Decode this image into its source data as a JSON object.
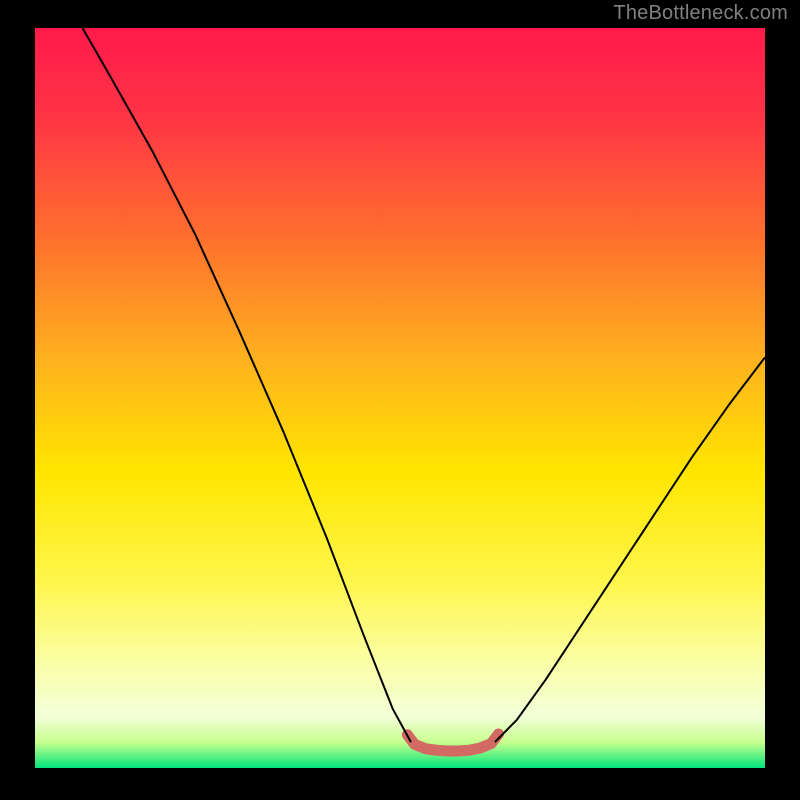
{
  "watermark": "TheBottleneck.com",
  "chart_data": {
    "type": "line",
    "title": "",
    "xlabel": "",
    "ylabel": "",
    "xlim": [
      0,
      100
    ],
    "ylim": [
      0,
      100
    ],
    "background_gradient_stops": [
      {
        "offset": 0.0,
        "color": "#ff1a4b"
      },
      {
        "offset": 0.12,
        "color": "#ff3445"
      },
      {
        "offset": 0.28,
        "color": "#ff6e2e"
      },
      {
        "offset": 0.45,
        "color": "#ffb21e"
      },
      {
        "offset": 0.6,
        "color": "#ffe600"
      },
      {
        "offset": 0.75,
        "color": "#fff64d"
      },
      {
        "offset": 0.86,
        "color": "#fbffa8"
      },
      {
        "offset": 0.93,
        "color": "#f3ffd8"
      },
      {
        "offset": 0.965,
        "color": "#c8ff8f"
      },
      {
        "offset": 1.0,
        "color": "#00e67a"
      }
    ],
    "series": [
      {
        "name": "left-branch",
        "stroke": "#000000",
        "stroke_width": 2.0,
        "points": [
          {
            "x": 6.5,
            "y": 100.0
          },
          {
            "x": 10.0,
            "y": 94.0
          },
          {
            "x": 16.0,
            "y": 83.5
          },
          {
            "x": 22.0,
            "y": 72.0
          },
          {
            "x": 28.0,
            "y": 59.0
          },
          {
            "x": 34.0,
            "y": 45.5
          },
          {
            "x": 40.0,
            "y": 31.0
          },
          {
            "x": 45.0,
            "y": 18.0
          },
          {
            "x": 49.0,
            "y": 8.0
          },
          {
            "x": 51.5,
            "y": 3.5
          }
        ]
      },
      {
        "name": "right-branch",
        "stroke": "#000000",
        "stroke_width": 2.0,
        "points": [
          {
            "x": 63.0,
            "y": 3.5
          },
          {
            "x": 66.0,
            "y": 6.5
          },
          {
            "x": 70.0,
            "y": 12.0
          },
          {
            "x": 75.0,
            "y": 19.5
          },
          {
            "x": 80.0,
            "y": 27.0
          },
          {
            "x": 85.0,
            "y": 34.5
          },
          {
            "x": 90.0,
            "y": 42.0
          },
          {
            "x": 95.0,
            "y": 49.0
          },
          {
            "x": 100.0,
            "y": 55.5
          }
        ]
      },
      {
        "name": "valley-marker",
        "stroke": "#d26a63",
        "stroke_width": 11,
        "linecap": "round",
        "points": [
          {
            "x": 51.0,
            "y": 4.5
          },
          {
            "x": 52.0,
            "y": 3.2
          },
          {
            "x": 53.5,
            "y": 2.6
          },
          {
            "x": 55.0,
            "y": 2.4
          },
          {
            "x": 56.5,
            "y": 2.3
          },
          {
            "x": 58.0,
            "y": 2.3
          },
          {
            "x": 59.5,
            "y": 2.4
          },
          {
            "x": 61.0,
            "y": 2.7
          },
          {
            "x": 62.5,
            "y": 3.3
          },
          {
            "x": 63.5,
            "y": 4.6
          }
        ]
      }
    ]
  }
}
